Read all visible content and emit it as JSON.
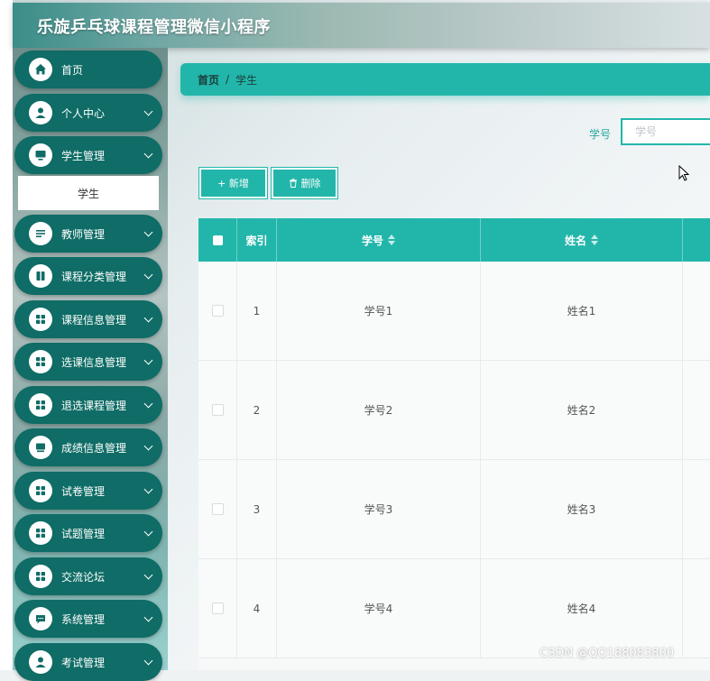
{
  "app": {
    "title": "乐旋乒乓球课程管理微信小程序"
  },
  "sidebar": {
    "items": [
      {
        "label": "首页",
        "icon": "home-icon",
        "chevron": false
      },
      {
        "label": "个人中心",
        "icon": "user-icon",
        "chevron": true
      },
      {
        "label": "学生管理",
        "icon": "monitor-icon",
        "chevron": true
      },
      {
        "label": "教师管理",
        "icon": "list-icon",
        "chevron": true
      },
      {
        "label": "课程分类管理",
        "icon": "book-icon",
        "chevron": true
      },
      {
        "label": "课程信息管理",
        "icon": "grid-icon",
        "chevron": true
      },
      {
        "label": "选课信息管理",
        "icon": "grid-icon",
        "chevron": true
      },
      {
        "label": "退选课程管理",
        "icon": "grid-icon",
        "chevron": true
      },
      {
        "label": "成绩信息管理",
        "icon": "screen-icon",
        "chevron": true
      },
      {
        "label": "试卷管理",
        "icon": "grid-icon",
        "chevron": true
      },
      {
        "label": "试题管理",
        "icon": "grid-icon",
        "chevron": true
      },
      {
        "label": "交流论坛",
        "icon": "grid-icon",
        "chevron": true
      },
      {
        "label": "系统管理",
        "icon": "chat-icon",
        "chevron": true
      },
      {
        "label": "考试管理",
        "icon": "user-icon",
        "chevron": true
      }
    ],
    "submenu_active": "学生"
  },
  "breadcrumb": {
    "home": "首页",
    "separator": "/",
    "current": "学生"
  },
  "search": {
    "label": "学号",
    "placeholder": "学号"
  },
  "toolbar": {
    "add_label": "+ 新增",
    "delete_label": "删除"
  },
  "table": {
    "columns": [
      "",
      "索引",
      "学号",
      "姓名"
    ],
    "rows": [
      {
        "index": "1",
        "student_id": "学号1",
        "name": "姓名1"
      },
      {
        "index": "2",
        "student_id": "学号2",
        "name": "姓名2"
      },
      {
        "index": "3",
        "student_id": "学号3",
        "name": "姓名3"
      },
      {
        "index": "4",
        "student_id": "学号4",
        "name": "姓名4"
      }
    ]
  },
  "watermark": "CSDN @QQ188083800",
  "colors": {
    "accent": "#22b6aa",
    "menu_bg": "#0f6c66"
  }
}
